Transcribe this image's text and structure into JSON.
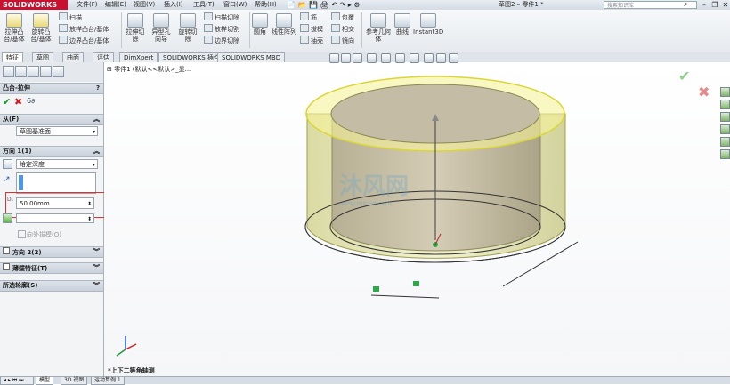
{
  "app": {
    "logo": "SOLIDWORKS",
    "doc_title": "草图2 – 零件1 *",
    "search_placeholder": "搜索知识库"
  },
  "menu": [
    "文件(F)",
    "编辑(E)",
    "视图(V)",
    "插入(I)",
    "工具(T)",
    "窗口(W)",
    "帮助(H)"
  ],
  "ribbon": {
    "big": [
      "拉伸凸台/基体",
      "旋转凸台/基体",
      "拉伸切除",
      "异型孔向导",
      "旋转切除",
      "圆角",
      "线性阵列",
      "参考几何体",
      "曲线",
      "Instant3D"
    ],
    "small_a": [
      "扫描",
      "放样凸台/基体",
      "边界凸台/基体"
    ],
    "small_b": [
      "扫描切除",
      "放样切割",
      "边界切除"
    ],
    "small_c": [
      "筋",
      "拔模",
      "抽壳"
    ],
    "small_d": [
      "包覆",
      "相交",
      "镜向"
    ]
  },
  "tabs": [
    "特征",
    "草图",
    "曲面",
    "评估",
    "DimXpert",
    "SOLIDWORKS 插件",
    "SOLIDWORKS MBD"
  ],
  "panel": {
    "feature_name": "凸台-拉伸",
    "help": "?",
    "from_label": "从(F)",
    "from_value": "草图基准面",
    "direction1_label": "方向 1(1)",
    "end_condition": "给定深度",
    "depth_value": "50.00mm",
    "draft_outward": "向外拔模(O)",
    "direction2_label": "方向 2(2)",
    "thin_feature_label": "薄壁特征(T)",
    "selected_contours_label": "所选轮廓(S)"
  },
  "tree": {
    "root": "零件1 (默认<<默认>_显..."
  },
  "viewport": {
    "view_label": "*上下二等角轴测",
    "watermark": "沐风网",
    "watermark_url": "www.mfcad.com"
  },
  "status_tabs": [
    "模型",
    "3D 视图",
    "运动算例 1"
  ]
}
